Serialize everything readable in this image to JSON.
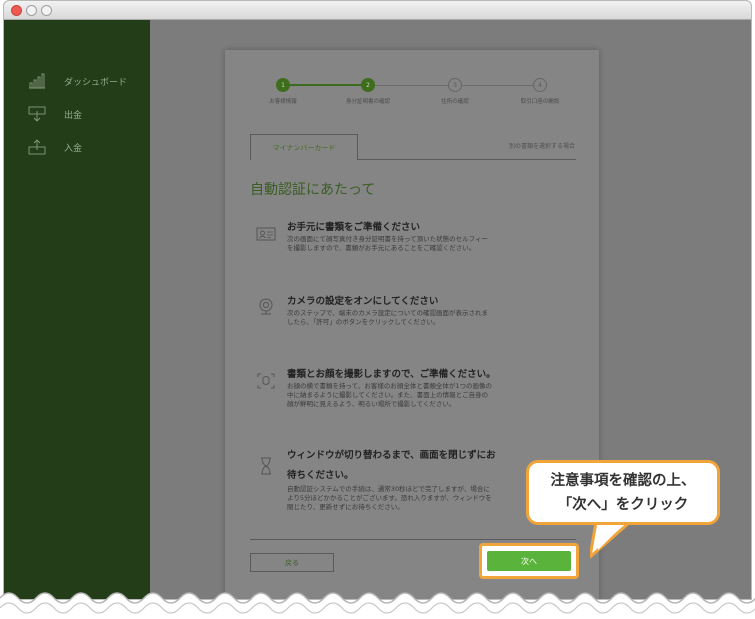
{
  "sidebar": {
    "items": [
      {
        "label": "ダッシュボード",
        "icon": "bar-chart-icon"
      },
      {
        "label": "出金",
        "icon": "withdraw-icon"
      },
      {
        "label": "入金",
        "icon": "deposit-icon"
      }
    ]
  },
  "steps": [
    {
      "number": "1",
      "label": "お客様情報",
      "state": "done"
    },
    {
      "number": "2",
      "label": "身分証明書の確認",
      "state": "active"
    },
    {
      "number": "3",
      "label": "住所の確認",
      "state": "todo"
    },
    {
      "number": "4",
      "label": "取引口座の開設",
      "state": "todo"
    }
  ],
  "tabs": {
    "active": "マイナンバーカード",
    "alternate_link": "別の書類を選択する場合"
  },
  "heading": "自動認証にあたって",
  "items": [
    {
      "icon": "id-card-icon",
      "title": "お手元に書類をご準備ください",
      "body": "次の画面にて顔写真付き身分証明書を持って頂いた状態のセルフィーを撮影しますので、書類がお手元にあることをご確認ください。"
    },
    {
      "icon": "camera-icon",
      "title": "カメラの設定をオンにしてください",
      "body": "次のステップで、端末のカメラ設定についての確認画面が表示されましたら、「許可」のボタンをクリックしてください。"
    },
    {
      "icon": "face-scan-icon",
      "title": "書類とお顔を撮影しますので、ご準備ください。",
      "body": "お顔の横で書類を持って、お客様のお顔全体と書類全体が1つの画像の中に納まるように撮影してください。また、書面上の情報とご自身の顔が鮮明に見えるよう、明るい場所で撮影してください。"
    },
    {
      "icon": "hourglass-icon",
      "title": "ウィンドウが切り替わるまで、画面を閉じずにお",
      "title2": "待ちください。",
      "body": "自動認証システムでの手続は、通常30秒ほどで完了しますが、場合により5分ほどかかることがございます。恐れ入りますが、ウィンドウを閉じたり、更新せずにお待ちください。"
    }
  ],
  "buttons": {
    "back": "戻る",
    "next": "次へ"
  },
  "callout": {
    "line1": "注意事項を確認の上、",
    "line2": "「次へ」をクリック"
  },
  "colors": {
    "sidebar": "#223d18",
    "accent": "#3f6d1e",
    "next_button": "#5ab33a",
    "highlight": "#f0a43a"
  }
}
